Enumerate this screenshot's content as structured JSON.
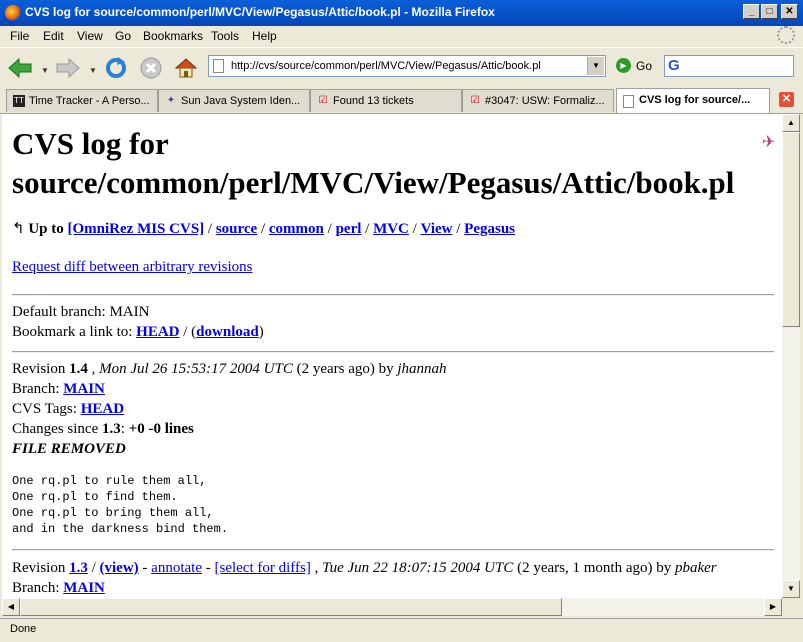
{
  "window": {
    "title": "CVS log for source/common/perl/MVC/View/Pegasus/Attic/book.pl - Mozilla Firefox",
    "min_glyph": "_",
    "max_glyph": "□",
    "close_glyph": "✕"
  },
  "menu": [
    "File",
    "Edit",
    "View",
    "Go",
    "Bookmarks",
    "Tools",
    "Help"
  ],
  "toolbar": {
    "url": "http://cvs/source/common/perl/MVC/View/Pegasus/Attic/book.pl",
    "go_label": "Go",
    "search_logo": "G"
  },
  "tabs": [
    {
      "label": "Time Tracker - A Perso...",
      "icon": "tt-icon"
    },
    {
      "label": "Sun Java System Iden...",
      "icon": "sun-icon"
    },
    {
      "label": "Found 13 tickets",
      "icon": "trac-icon"
    },
    {
      "label": "#3047: USW: Formaliz...",
      "icon": "trac-icon"
    },
    {
      "label": "CVS log for source/...",
      "icon": "page-icon"
    }
  ],
  "page": {
    "title_line1": "CVS log for",
    "title_line2": "source/common/perl/MVC/View/Pegasus/Attic/book.pl",
    "up_to_label": "Up to",
    "breadcrumb": [
      "[OmniRez MIS CVS]",
      "source",
      "common",
      "perl",
      "MVC",
      "View",
      "Pegasus"
    ],
    "sep": "/",
    "request_diff": "Request diff between arbitrary revisions",
    "default_branch_label": "Default branch:",
    "default_branch_value": "MAIN",
    "bookmark_label": "Bookmark a link to:",
    "bookmark_head": "HEAD",
    "bookmark_download": "download",
    "rev14": {
      "revision_label": "Revision",
      "revision": "1.4",
      "date": "Mon Jul 26 15:53:17 2004 UTC",
      "age": "(2 years ago)",
      "by_label": "by",
      "author": "jhannah",
      "branch_label": "Branch:",
      "branch": "MAIN",
      "tags_label": "CVS Tags:",
      "tag": "HEAD",
      "changes_label": "Changes since",
      "changes_rev": "1.3",
      "changes_value": "+0 -0 lines",
      "removed": "FILE REMOVED",
      "message": "One rq.pl to rule them all,\nOne rq.pl to find them.\nOne rq.pl to bring them all,\nand in the darkness bind them."
    },
    "rev13": {
      "revision_label": "Revision",
      "revision": "1.3",
      "view": "(view)",
      "annotate": "annotate",
      "select": "[select for diffs]",
      "date": "Tue Jun 22 18:07:15 2004 UTC",
      "age": "(2 years, 1 month ago)",
      "by_label": "by",
      "author": "pbaker",
      "branch_label": "Branch:",
      "branch": "MAIN"
    }
  },
  "status": "Done"
}
